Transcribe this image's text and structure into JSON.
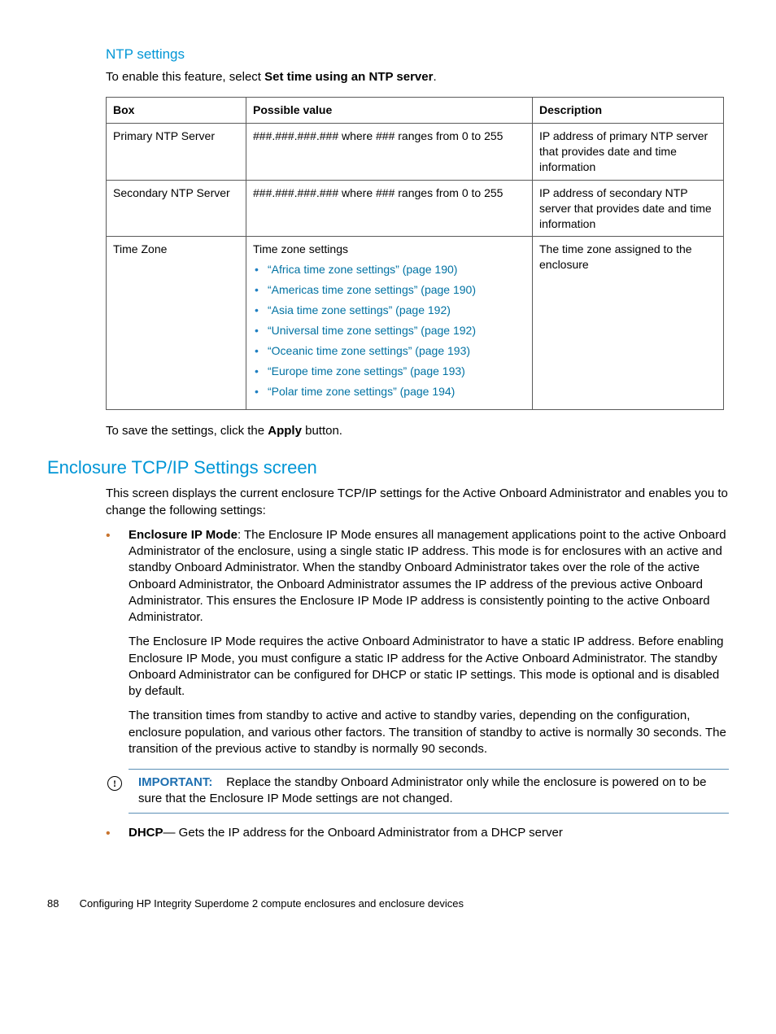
{
  "heading_ntp": "NTP settings",
  "intro_prefix": "To enable this feature, select ",
  "intro_bold": "Set time using an NTP server",
  "intro_suffix": ".",
  "table": {
    "headers": [
      "Box",
      "Possible value",
      "Description"
    ],
    "rows": [
      {
        "box": "Primary NTP Server",
        "value": "###.###.###.### where ### ranges from 0 to 255",
        "desc": "IP address of primary NTP server that provides date and time information"
      },
      {
        "box": "Secondary NTP Server",
        "value": "###.###.###.### where ### ranges from 0 to 255",
        "desc": "IP address of secondary NTP server that provides date and time information"
      },
      {
        "box": "Time Zone",
        "value_lead": "Time zone settings",
        "bullets": [
          "“Africa time zone settings” (page 190)",
          "“Americas time zone settings” (page 190)",
          "“Asia time zone settings” (page 192)",
          "“Universal time zone settings” (page 192)",
          "“Oceanic time zone settings” (page 193)",
          "“Europe time zone settings” (page 193)",
          "“Polar time zone settings” (page 194)"
        ],
        "desc": "The time zone assigned to the enclosure"
      }
    ]
  },
  "save_prefix": "To save the settings, click the ",
  "save_bold": "Apply",
  "save_suffix": " button.",
  "heading_tcp": "Enclosure TCP/IP Settings screen",
  "tcp_intro": "This screen displays the current enclosure TCP/IP settings for the Active Onboard Administrator and enables you to change the following settings:",
  "bullet1_label": "Enclosure IP Mode",
  "bullet1_p1": ": The Enclosure IP Mode ensures all management applications point to the active Onboard Administrator of the enclosure, using a single static IP address. This mode is for enclosures with an active and standby Onboard Administrator. When the standby Onboard Administrator takes over the role of the active Onboard Administrator, the Onboard Administrator assumes the IP address of the previous active Onboard Administrator. This ensures the Enclosure IP Mode IP address is consistently pointing to the active Onboard Administrator.",
  "bullet1_p2": "The Enclosure IP Mode requires the active Onboard Administrator to have a static IP address. Before enabling Enclosure IP Mode, you must configure a static IP address for the Active Onboard Administrator. The standby Onboard Administrator can be configured for DHCP or static IP settings. This mode is optional and is disabled by default.",
  "bullet1_p3": "The transition times from standby to active and active to standby varies, depending on the configuration, enclosure population, and various other factors. The transition of standby to active is normally 30 seconds. The transition of the previous active to standby is normally 90 seconds.",
  "important_label": "IMPORTANT:",
  "important_text": "Replace the standby Onboard Administrator only while the enclosure is powered on to be sure that the Enclosure IP Mode settings are not changed.",
  "bullet2_label": "DHCP",
  "bullet2_text": "— Gets the IP address for the Onboard Administrator from a DHCP server",
  "footer_page": "88",
  "footer_text": "Configuring HP Integrity Superdome 2 compute enclosures and enclosure devices"
}
